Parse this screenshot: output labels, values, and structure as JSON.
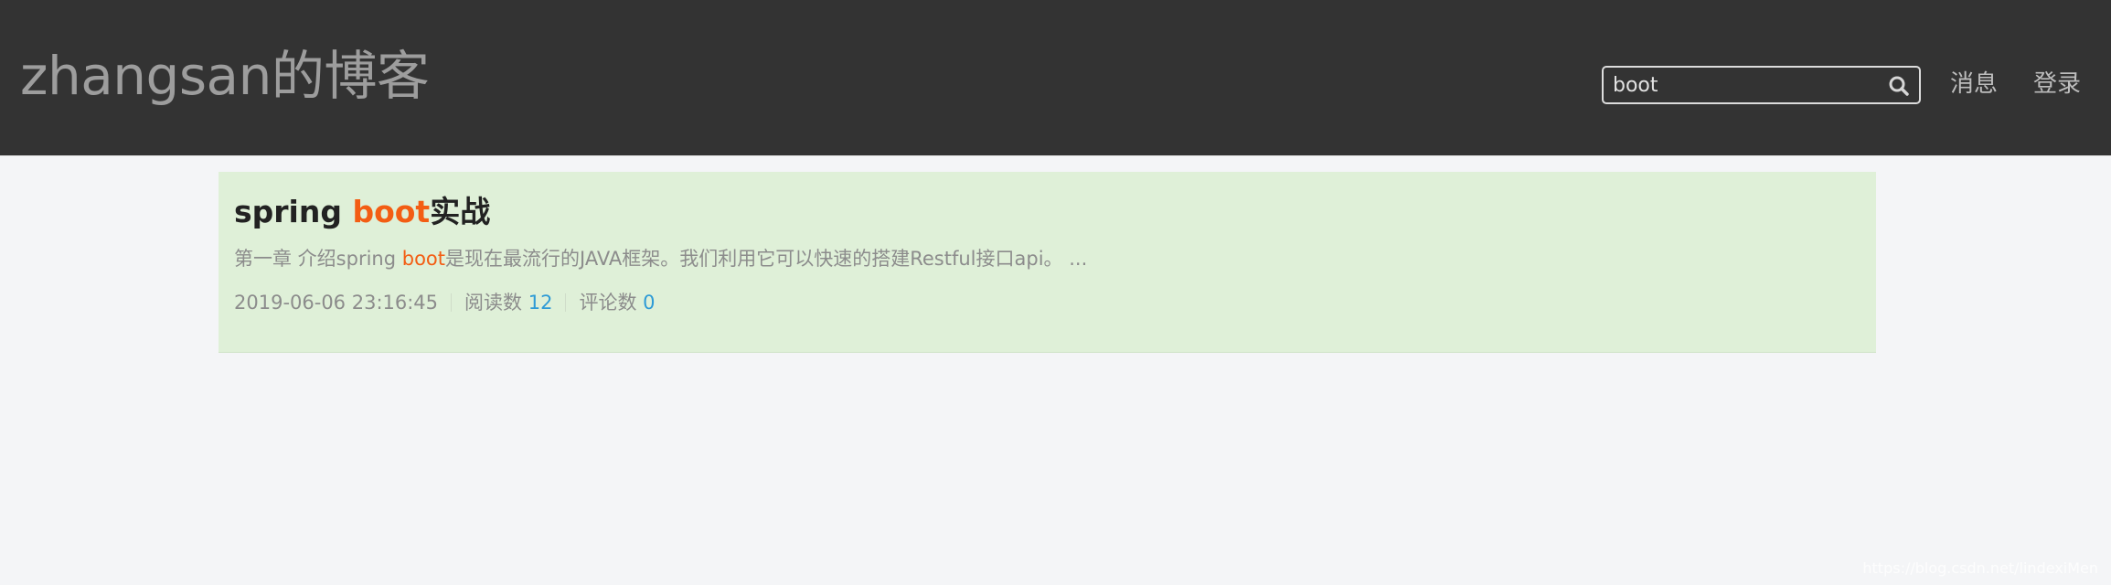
{
  "header": {
    "brand": "zhangsan的博客",
    "search": {
      "value": "boot"
    },
    "nav": [
      {
        "label": "消息"
      },
      {
        "label": "登录"
      }
    ]
  },
  "results": [
    {
      "title_prefix": "spring ",
      "title_highlight": "boot",
      "title_suffix": "实战",
      "summary_prefix": "第一章 介绍spring ",
      "summary_highlight": "boot",
      "summary_suffix": "是现在最流行的JAVA框架。我们利用它可以快速的搭建Restful接口api。 ...",
      "date": "2019-06-06 23:16:45",
      "reads_label": "阅读数 ",
      "reads": "12",
      "comments_label": "评论数 ",
      "comments": "0"
    }
  ],
  "watermark": "https://blog.csdn.net/lindexiMen",
  "colors": {
    "header_bg": "#333333",
    "card_bg": "#dff0d8",
    "highlight": "#f35d13",
    "count": "#2e9bd6",
    "page_bg": "#f4f5f7"
  }
}
